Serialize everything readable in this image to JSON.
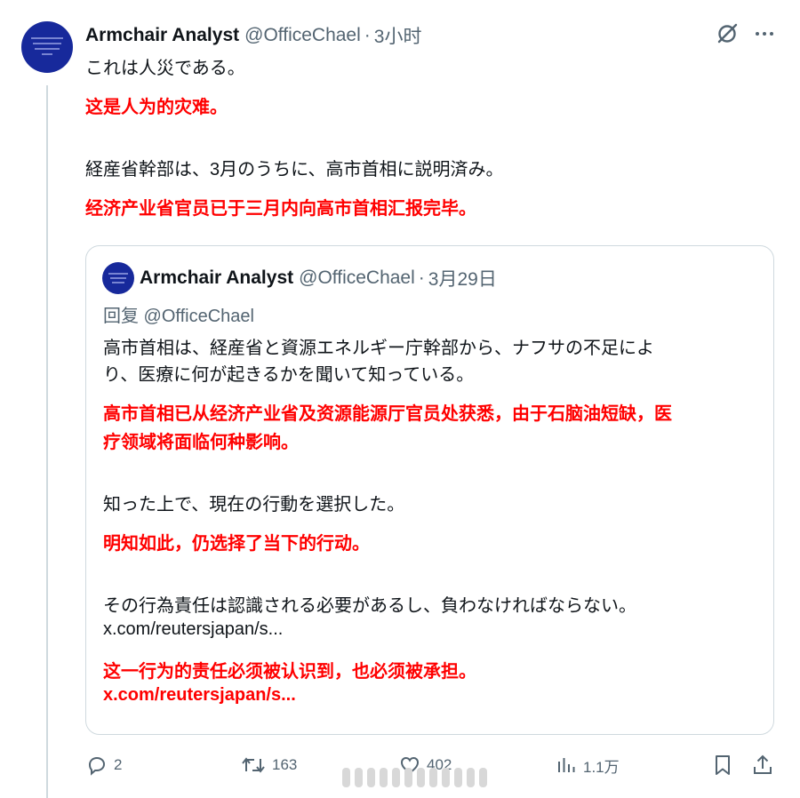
{
  "tweet": {
    "author": {
      "name": "Armchair Analyst",
      "handle": "@OfficeChael"
    },
    "separator": "·",
    "time": "3小时",
    "lines": {
      "jp1": "これは人災である。",
      "cn1": "这是人为的灾难。",
      "jp2": "経産省幹部は、3月のうちに、高市首相に説明済み。",
      "cn2": "经济产业省官员已于三月内向高市首相汇报完毕。"
    },
    "icons": {
      "grok": "grok-icon",
      "more": "more-icon"
    }
  },
  "quote": {
    "author": {
      "name": "Armchair Analyst",
      "handle": "@OfficeChael"
    },
    "separator": "·",
    "time": "3月29日",
    "reply_to": "回复 @OfficeChael",
    "lines": {
      "jp1a": "高市首相は、経産省と資源エネルギー庁幹部から、ナフサの不足によ",
      "jp1b": "り、医療に何が起きるかを聞いて知っている。",
      "cn1a": "高市首相已从经济产业省及资源能源厅官员处获悉，由于石脑油短缺，医",
      "cn1b": "疗领域将面临何种影响。",
      "jp2": "知った上で、現在の行動を選択した。",
      "cn2": "明知如此，仍选择了当下的行动。",
      "jp3": "その行為責任は認識される必要があるし、負わなければならない。",
      "link": "x.com/reutersjapan/s...",
      "cn3": "这一行为的责任必须被认识到，也必须被承担。",
      "cnlink": "x.com/reutersjapan/s..."
    }
  },
  "actions": {
    "reply": {
      "icon": "reply-icon",
      "count": "2"
    },
    "retweet": {
      "icon": "retweet-icon",
      "count": "163"
    },
    "like": {
      "icon": "like-icon",
      "count": "402"
    },
    "views": {
      "icon": "views-icon",
      "count": "1.1万"
    },
    "bookmark": {
      "icon": "bookmark-icon"
    },
    "share": {
      "icon": "share-icon"
    }
  },
  "colors": {
    "accent_red": "#ff0000",
    "muted": "#536471",
    "border": "#cfd9de",
    "avatar": "#17299b"
  }
}
